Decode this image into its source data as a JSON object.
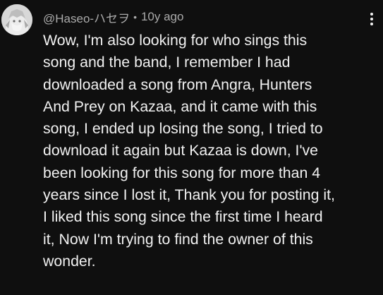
{
  "comment": {
    "author": "@Haseo-ハセヲ",
    "separator": "•",
    "timestamp": "10y ago",
    "text": "Wow, I'm also looking for who sings this\nsong and the band, I remember I had\ndownloaded a song from Angra, Hunters\nAnd Prey on Kazaa, and it came with this\nsong, I ended up losing the song, I tried to\ndownload it again but Kazaa is down, I've\nbeen looking for this song for more than 4\nyears since I lost it, Thank you for posting it,\nI liked this song since the first time I heard\nit, Now I'm trying to find the owner of this\nwonder.",
    "avatar_icon": "user-avatar",
    "menu_icon": "more-vertical-icon"
  },
  "colors": {
    "background": "#0f0f0f",
    "primary_text": "#f1f1f1",
    "secondary_text": "#aaaaaa"
  }
}
